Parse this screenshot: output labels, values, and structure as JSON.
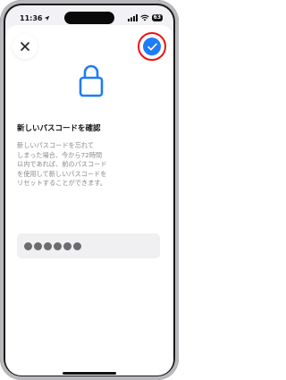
{
  "status_bar": {
    "time": "11:36",
    "battery": "63"
  },
  "sheet": {
    "title": "新しいパスコードを確認",
    "description": "新しいパスコードを忘れて\nしまった場合、今から72時間\n以内であれば、前のパスコード\nを使用して新しいパスコードを\nリセットすることができます。",
    "passcode_field": {
      "entered_digits": 6
    }
  },
  "colors": {
    "accent": "#1e7cf7",
    "highlight_ring": "#e11111"
  },
  "icons": {
    "close": "close-icon",
    "done": "checkmark-icon",
    "lock": "lock-icon"
  }
}
